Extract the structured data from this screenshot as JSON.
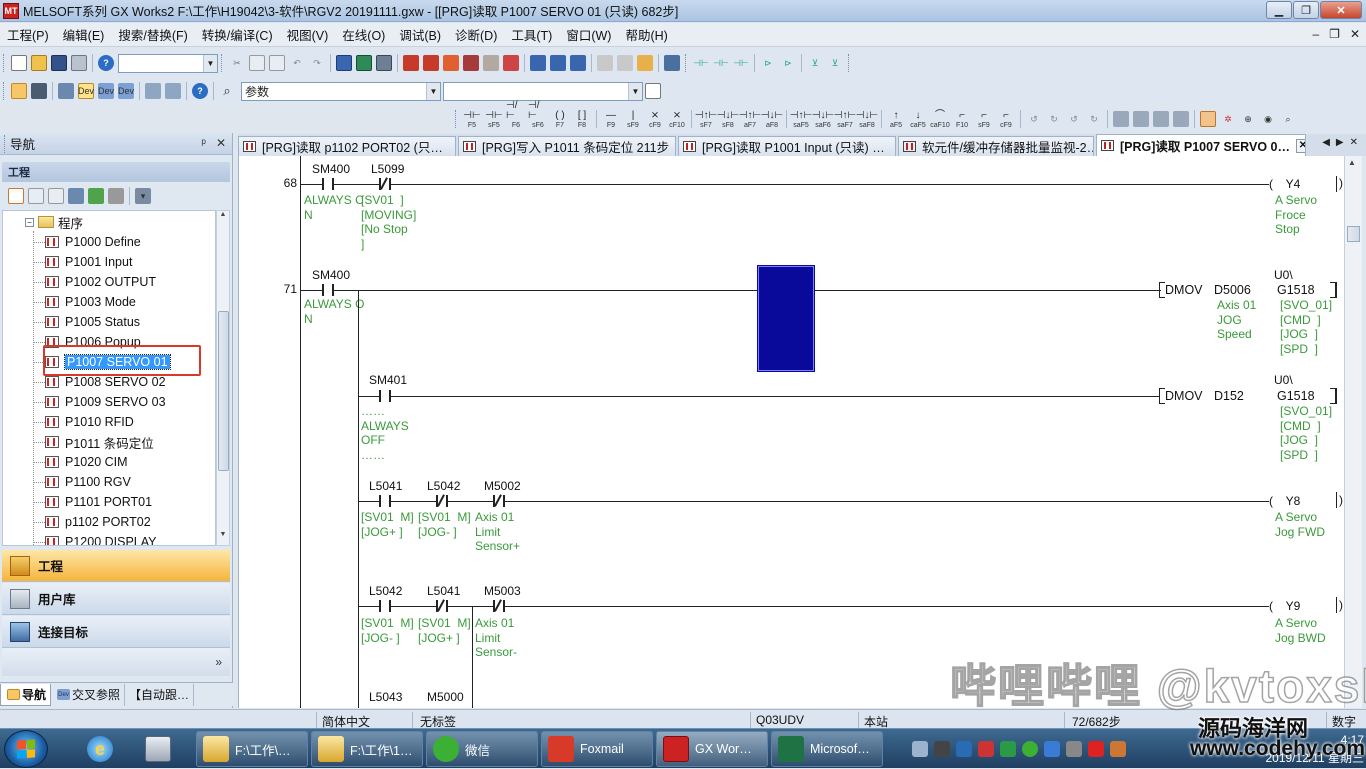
{
  "window": {
    "title": "MELSOFT系列 GX Works2 F:\\工作\\H19042\\3-软件\\RGV2 20191111.gxw - [[PRG]读取 P1007 SERVO 01 (只读) 682步]",
    "app_icon": "MT"
  },
  "menu": [
    {
      "label": "工程(P)"
    },
    {
      "label": "编辑(E)"
    },
    {
      "label": "搜索/替换(F)"
    },
    {
      "label": "转换/编译(C)"
    },
    {
      "label": "视图(V)"
    },
    {
      "label": "在线(O)"
    },
    {
      "label": "调试(B)"
    },
    {
      "label": "诊断(D)"
    },
    {
      "label": "工具(T)"
    },
    {
      "label": "窗口(W)"
    },
    {
      "label": "帮助(H)"
    }
  ],
  "toolbar": {
    "combo_device": "",
    "combo_param": "参数",
    "combo_empty": "",
    "fkeys": [
      "F5",
      "sF5",
      "F6",
      "sF6",
      "F7",
      "F8",
      "F9",
      "sF9",
      "cF9",
      "cF10",
      "sF7",
      "sF8",
      "aF7",
      "aF8",
      "saF5",
      "saF6",
      "saF7",
      "saF8",
      "aF5",
      "caF5",
      "caF10",
      "F10",
      "sF9",
      "cF9"
    ]
  },
  "nav": {
    "title": "导航",
    "controls": [
      "ᵖ",
      "✕"
    ],
    "section": "工程",
    "folder": "程序",
    "items": [
      {
        "label": "P1000 Define"
      },
      {
        "label": "P1001 Input"
      },
      {
        "label": "P1002 OUTPUT"
      },
      {
        "label": "P1003 Mode"
      },
      {
        "label": "P1005 Status"
      },
      {
        "label": "P1006 Popup"
      },
      {
        "label": "P1007 SERVO 01"
      },
      {
        "label": "P1008 SERVO 02"
      },
      {
        "label": "P1009 SERVO 03"
      },
      {
        "label": "P1010 RFID"
      },
      {
        "label": "P1011 条码定位"
      },
      {
        "label": "P1020 CIM"
      },
      {
        "label": "P1100 RGV"
      },
      {
        "label": "P1101 PORT01"
      },
      {
        "label": "p1102 PORT02"
      },
      {
        "label": "P1200 DISPLAY"
      }
    ],
    "selected_index": 6,
    "buttons": [
      {
        "label": "工程",
        "active": true
      },
      {
        "label": "用户库",
        "active": false
      },
      {
        "label": "连接目标",
        "active": false
      }
    ],
    "more": "»",
    "bottom_tabs": [
      {
        "label": "导航",
        "active": true
      },
      {
        "label": "交叉参照",
        "active": false
      },
      {
        "label": "【自动跟…",
        "active": false
      }
    ]
  },
  "tabs": [
    {
      "label": "[PRG]读取 p1102 PORT02 (只…",
      "active": false
    },
    {
      "label": "[PRG]写入 P1011 条码定位 211步",
      "active": false
    },
    {
      "label": "[PRG]读取 P1001 Input (只读) …",
      "active": false
    },
    {
      "label": "软元件/缓冲存储器批量监视-2…",
      "active": false
    },
    {
      "label": "[PRG]读取 P1007 SERVO 0…",
      "active": true
    }
  ],
  "ladder": {
    "r68": {
      "step": "68",
      "c1_dev": "SM400",
      "c1_cmt": "ALWAYS C\nN",
      "c2_dev": "L5099",
      "c2_cmt": "[SV01  ]\n[MOVING]\n[No Stop\n]",
      "coil": "Y4",
      "coil_cmt": "A Servo\nFroce\nStop"
    },
    "r71": {
      "step": "71",
      "c1_dev": "SM400",
      "c1_cmt": "ALWAYS O\nN",
      "inst1": "DMOV",
      "src1": "D5006",
      "src1_cmt": "Axis 01\nJOG\nSpeed",
      "dst1_pre": "U0\\",
      "dst1": "G1518",
      "dst1_cmt": "[SVO_01]\n[CMD  ]\n[JOG  ]\n[SPD  ]",
      "c2_dev": "SM401",
      "c2_cmt": "……\nALWAYS\nOFF\n……",
      "inst2": "DMOV",
      "src2": "D152",
      "dst2_pre": "U0\\",
      "dst2": "G1518",
      "dst2_cmt": "[SVO_01]\n[CMD  ]\n[JOG  ]\n[SPD  ]"
    },
    "r_y8": {
      "a_dev": "L5041",
      "a_cmt": "[SV01  M]\n[JOG+ ]",
      "b_dev": "L5042",
      "b_cmt": "[SV01  M]\n[JOG- ]",
      "c_dev": "M5002",
      "c_cmt": "Axis 01\nLimit\nSensor+",
      "coil": "Y8",
      "coil_cmt": "A Servo\nJog FWD"
    },
    "r_y9": {
      "a_dev": "L5042",
      "a_cmt": "[SV01  M]\n[JOG- ]",
      "b_dev": "L5041",
      "b_cmt": "[SV01  M]\n[JOG+ ]",
      "c_dev": "M5003",
      "c_cmt": "Axis 01\nLimit\nSensor-",
      "coil": "Y9",
      "coil_cmt": "A Servo\nJog BWD"
    },
    "r_next": {
      "a_dev": "L5043",
      "b_dev": "M5000"
    }
  },
  "status": {
    "lang": "简体中文",
    "label": "无标签",
    "cpu": "Q03UDV",
    "station": "本站",
    "steps": "72/682步",
    "mode": "数字"
  },
  "taskbar": {
    "apps": [
      {
        "label": "",
        "icon": "ie-icon"
      },
      {
        "label": "",
        "icon": "calculator-icon"
      },
      {
        "label": "F:\\工作\\…",
        "icon": "folder-icon"
      },
      {
        "label": "F:\\工作\\1…",
        "icon": "folder-icon"
      },
      {
        "label": "微信",
        "icon": "wechat-icon"
      },
      {
        "label": "Foxmail",
        "icon": "foxmail-icon"
      },
      {
        "label": "GX Wor…",
        "icon": "gxworks-icon"
      },
      {
        "label": "Microsof…",
        "icon": "excel-icon"
      }
    ],
    "clock_time": "4:17",
    "clock_date": "2019/12/11 星期三"
  },
  "watermarks": {
    "overlay": "哔哩哔哩 @kvtoxsky",
    "site_cn": "源码海洋网",
    "site_url": "www.codehy.com"
  }
}
